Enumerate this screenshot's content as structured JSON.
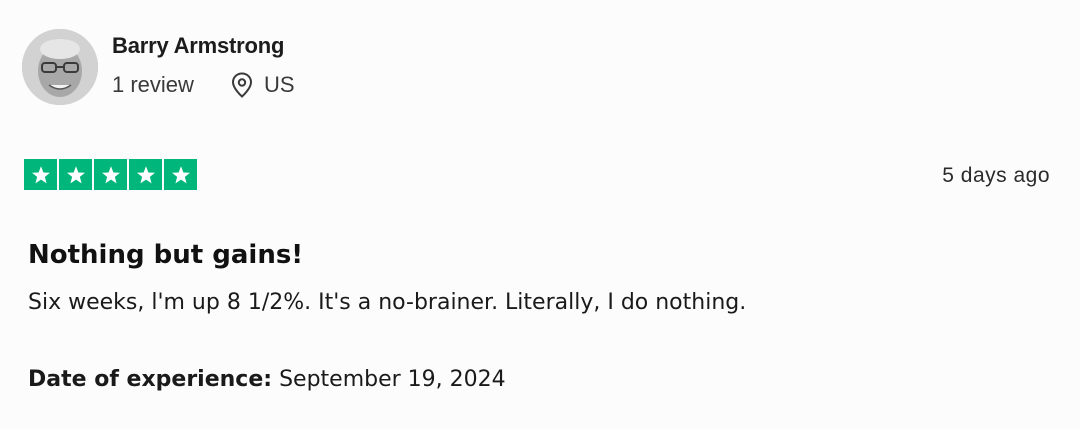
{
  "reviewer": {
    "name": "Barry Armstrong",
    "review_count": "1 review",
    "location": "US"
  },
  "review": {
    "rating": 5,
    "rating_max": 5,
    "date": "5 days ago",
    "title": "Nothing but gains!",
    "text": "Six weeks, l'm up 8 1/2%. It's a no-brainer. Literally, I do nothing.",
    "experience_label": "Date of experience:",
    "experience_date": "September 19, 2024"
  },
  "colors": {
    "star_fill": "#00b67a",
    "star_glyph": "#ffffff",
    "text": "#1a1a1a"
  },
  "icons": {
    "avatar": "avatar",
    "location": "location-pin-icon",
    "star": "star-icon"
  }
}
